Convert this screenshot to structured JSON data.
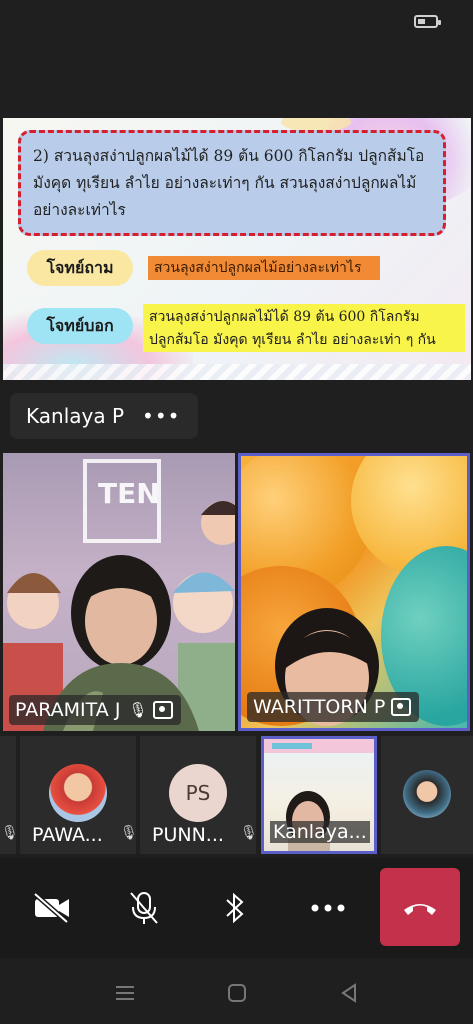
{
  "shared_slide": {
    "question_text": [
      "2) สวนลุงสง่าปลูกผลไม้ได้  89 ต้น  600  กิโลกรัม  ปลูกส้มโอ",
      "มังคุด  ทุเรียน  ลำไย  อย่างละเท่าๆ กัน  สวนลุงสง่าปลูกผลไม้",
      "อย่างละเท่าไร"
    ],
    "ask_label": "โจทย์ถาม",
    "ask_value": "สวนลุงสง่าปลูกผลไม้อย่างละเท่าไร",
    "give_label": "โจทย์บอก",
    "give_value": [
      "สวนลุงสง่าปลูกผลไม้ได้  89  ต้น  600  กิโลกรัม",
      "ปลูกส้มโอ  มังคุด  ทุเรียน   ลำไย  อย่างละเท่า ๆ กัน"
    ]
  },
  "presenter": {
    "name": "Kanlaya P",
    "menu": "•••"
  },
  "participants_main": [
    {
      "name": "PARAMITA J",
      "muted": true,
      "pinned_icon": "pin-icon"
    },
    {
      "name": "WARITTORN P",
      "muted": false,
      "pinned_icon": "pin-icon"
    }
  ],
  "participants_strip": [
    {
      "name": "PAWA...",
      "avatar": "photo"
    },
    {
      "name": "PUNN...",
      "initials": "PS"
    },
    {
      "name": "Kanlaya...",
      "avatar": "video"
    },
    {
      "name": "",
      "avatar": "photo"
    }
  ],
  "colors": {
    "accent": "#5b5fc7",
    "hangup": "#c4314b",
    "background": "#1f1f1f"
  },
  "controls": [
    "camera-off-icon",
    "mic-off-icon",
    "bluetooth-icon",
    "more-icon",
    "hang-up-icon"
  ]
}
